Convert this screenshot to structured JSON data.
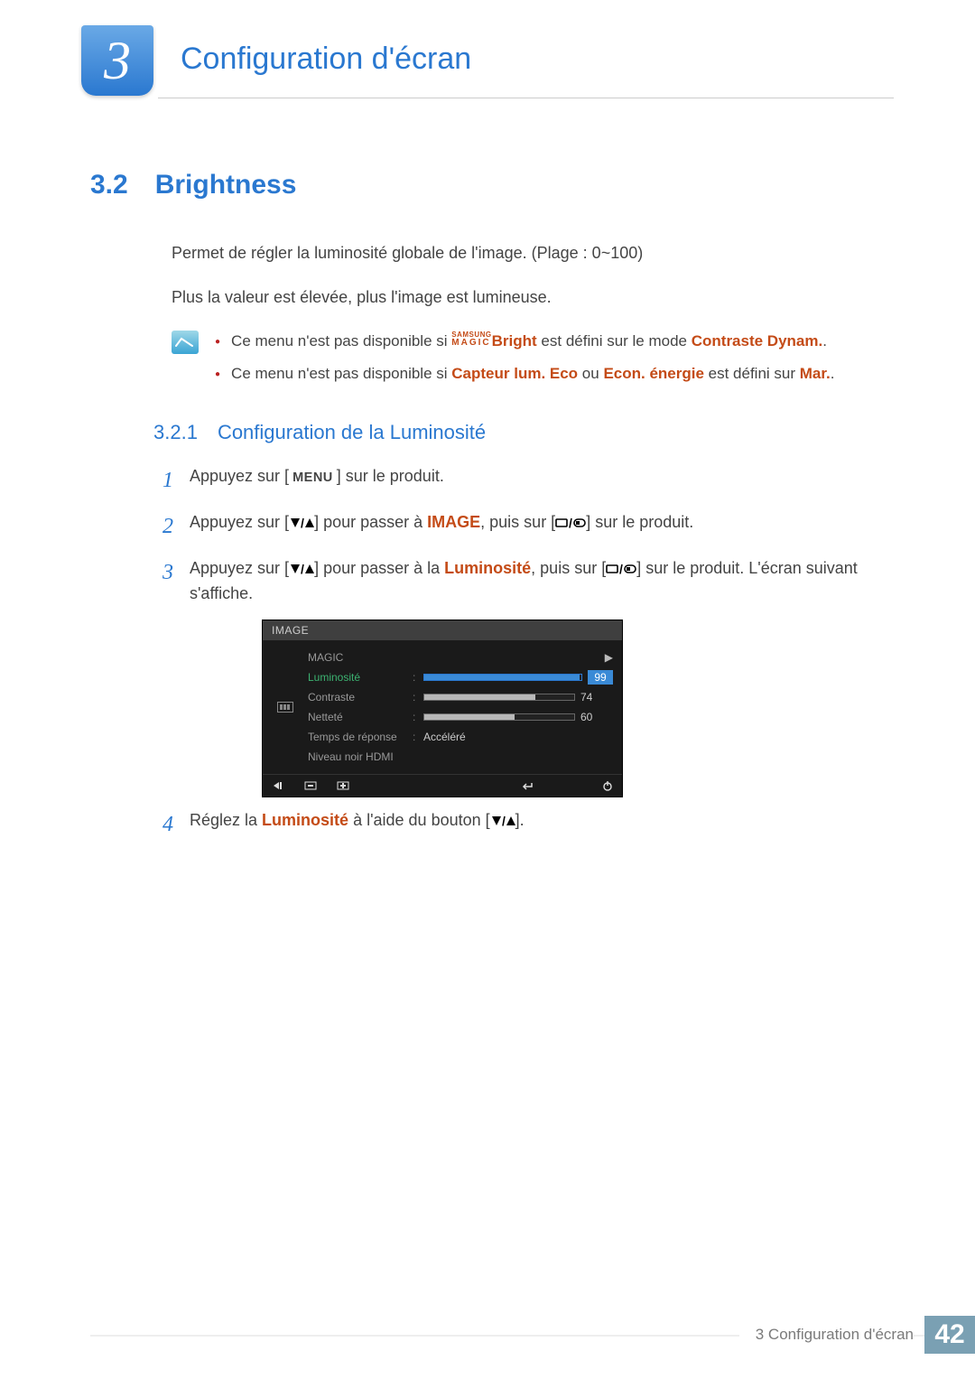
{
  "chapter": {
    "number": "3",
    "title": "Configuration d'écran"
  },
  "section": {
    "number": "3.2",
    "title": "Brightness",
    "p1": "Permet de régler la luminosité globale de l'image. (Plage : 0~100)",
    "p2": "Plus la valeur est élevée, plus l'image est lumineuse."
  },
  "notes": {
    "n1_a": "Ce menu n'est pas disponible si ",
    "n1_magic_top": "SAMSUNG",
    "n1_magic_bot": "MAGIC",
    "n1_bright": "Bright",
    "n1_b": " est défini sur le mode ",
    "n1_c": "Contraste Dynam.",
    "n1_d": ".",
    "n2_a": "Ce menu n'est pas disponible si ",
    "n2_b": "Capteur lum. Eco",
    "n2_c": " ou ",
    "n2_d": "Econ. énergie",
    "n2_e": " est défini sur ",
    "n2_f": "Mar.",
    "n2_g": "."
  },
  "subsection": {
    "number": "3.2.1",
    "title": "Configuration de la Luminosité"
  },
  "steps": {
    "s1": {
      "n": "1",
      "a": "Appuyez sur [",
      "menu": "MENU",
      "b": "] sur le produit."
    },
    "s2": {
      "n": "2",
      "a": "Appuyez sur [",
      "b": "] pour passer à ",
      "image": "IMAGE",
      "c": ", puis sur [",
      "d": "] sur le produit."
    },
    "s3": {
      "n": "3",
      "a": "Appuyez sur [",
      "b": "] pour passer à la ",
      "lum": "Luminosité",
      "c": ", puis sur [",
      "d": "] sur le produit. L'écran suivant s'affiche."
    },
    "s4": {
      "n": "4",
      "a": "Réglez la ",
      "lum": "Luminosité",
      "b": " à l'aide du bouton [",
      "c": "]."
    }
  },
  "osd": {
    "header": "IMAGE",
    "rows": {
      "magic": {
        "label": "MAGIC"
      },
      "lum": {
        "label": "Luminosité",
        "value": "99",
        "fill": 99
      },
      "contr": {
        "label": "Contraste",
        "value": "74",
        "fill": 74
      },
      "net": {
        "label": "Netteté",
        "value": "60",
        "fill": 60
      },
      "temps": {
        "label": "Temps de réponse",
        "value": "Accéléré"
      },
      "niveau": {
        "label": "Niveau noir HDMI"
      }
    }
  },
  "footer": {
    "text": "3 Configuration d'écran",
    "page": "42"
  }
}
